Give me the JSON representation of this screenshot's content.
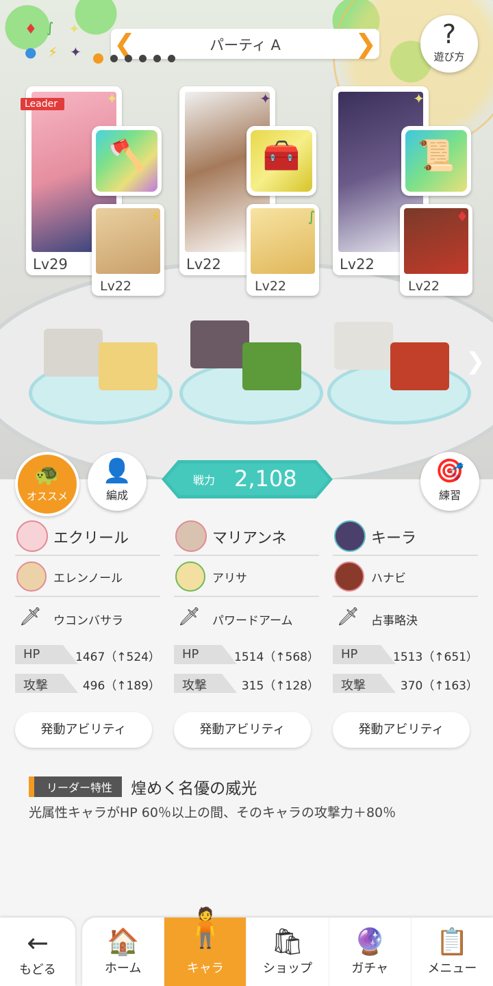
{
  "party": {
    "title": "パーティ A",
    "page_count": 6,
    "active_index": 0
  },
  "help": {
    "label": "遊び方",
    "icon": "question-icon"
  },
  "element_legend": [
    "fire",
    "wind",
    "light",
    "water",
    "thunder",
    "dark"
  ],
  "team": [
    {
      "leader": true,
      "leader_label": "Leader",
      "main": {
        "level": "Lv29",
        "element": "light"
      },
      "weapon": {
        "icon": "axe-icon"
      },
      "sub": {
        "level": "Lv22",
        "element": "thunder"
      }
    },
    {
      "leader": false,
      "main": {
        "level": "Lv22",
        "element": "dark"
      },
      "weapon": {
        "icon": "gauntlet-icon"
      },
      "sub": {
        "level": "Lv22",
        "element": "wind"
      }
    },
    {
      "leader": false,
      "main": {
        "level": "Lv22",
        "element": "light"
      },
      "weapon": {
        "icon": "scroll-icon"
      },
      "sub": {
        "level": "Lv22",
        "element": "fire"
      }
    }
  ],
  "actions": {
    "recommend": "オススメ",
    "formation": "編成",
    "practice": "練習"
  },
  "power": {
    "label": "戦力",
    "value": "2,108"
  },
  "columns": [
    {
      "main_name": "エクリール",
      "sub_name": "エレンノール",
      "weapon_name": "ウコンバサラ",
      "hp_label": "HP",
      "hp": "1467（↑524）",
      "atk_label": "攻撃",
      "atk": "496（↑189）",
      "ability": "発動アビリティ"
    },
    {
      "main_name": "マリアンネ",
      "sub_name": "アリサ",
      "weapon_name": "パワードアーム",
      "hp_label": "HP",
      "hp": "1514（↑568）",
      "atk_label": "攻撃",
      "atk": "315（↑128）",
      "ability": "発動アビリティ"
    },
    {
      "main_name": "キーラ",
      "sub_name": "ハナビ",
      "weapon_name": "占事略決",
      "hp_label": "HP",
      "hp": "1513（↑651）",
      "atk_label": "攻撃",
      "atk": "370（↑163）",
      "ability": "発動アビリティ"
    }
  ],
  "leader_skill": {
    "chip": "リーダー特性",
    "title": "煌めく名優の威光",
    "description": "光属性キャラがHP 60％以上の間、そのキャラの攻撃力＋80％"
  },
  "nav": {
    "back": "もどる",
    "tabs": [
      {
        "label": "ホーム",
        "icon": "home-icon"
      },
      {
        "label": "キャラ",
        "icon": "character-icon",
        "active": true
      },
      {
        "label": "ショップ",
        "icon": "shop-icon"
      },
      {
        "label": "ガチャ",
        "icon": "gacha-icon"
      },
      {
        "label": "メニュー",
        "icon": "menu-icon"
      }
    ]
  },
  "colors": {
    "accent": "#f39a22",
    "power": "#46c9bd",
    "fire": "#e23b3b",
    "wind": "#43b045",
    "light": "#e8d84a",
    "water": "#3a8fe0",
    "thunder": "#f2c21a",
    "dark": "#5a3a6e"
  }
}
